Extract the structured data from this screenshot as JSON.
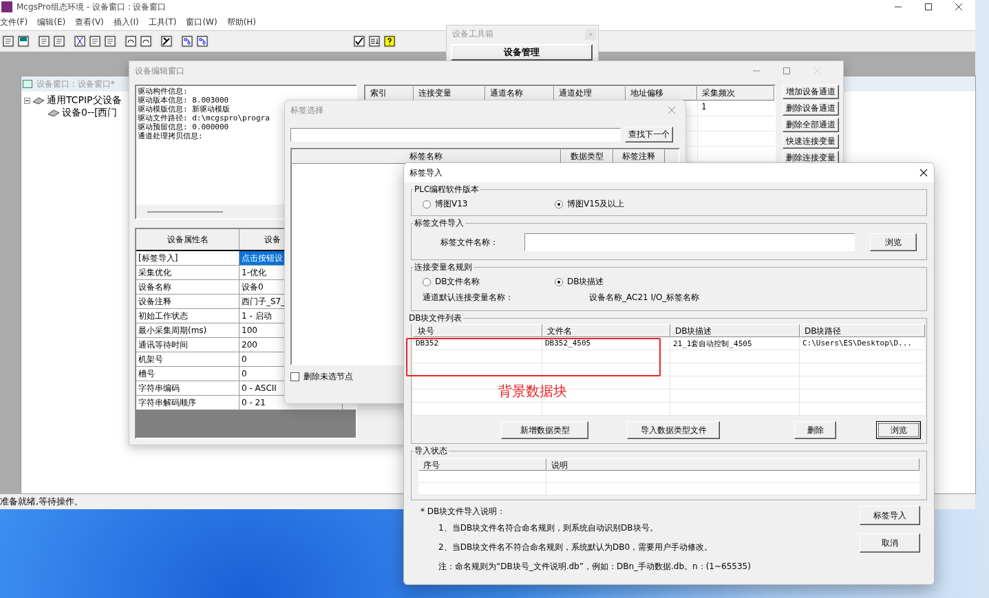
{
  "app": {
    "title": "McgsPro组态环境 - 设备窗口 : 设备窗口",
    "menu": [
      "文件(F)",
      "编辑(E)",
      "查看(V)",
      "插入(I)",
      "工具(T)",
      "窗口(W)",
      "帮助(H)"
    ],
    "status": "准备就绪,等待操作。"
  },
  "device_window": {
    "title": "设备窗口 : 设备窗口*",
    "tree": [
      {
        "label": "通用TCPIP父设备",
        "expanded": true,
        "children": [
          {
            "label": "设备0--[西门"
          }
        ]
      }
    ]
  },
  "toolbox": {
    "title": "设备工具箱",
    "button": "设备管理"
  },
  "editor": {
    "title": "设备编辑窗口",
    "info": [
      "驱动构件信息:",
      "驱动版本信息: 8.003000",
      "驱动模版信息: 新驱动模版",
      "驱动文件路径: d:\\mcgspro\\progra",
      "驱动预留信息: 0.000000",
      "通道处理拷贝信息:"
    ],
    "properties": {
      "columns": [
        "设备属性名",
        "设备"
      ],
      "rows": [
        {
          "name": "[标签导入]",
          "value": "点击按钮设",
          "selected": true
        },
        {
          "name": "采集优化",
          "value": "1-优化",
          "selected": false
        },
        {
          "name": "设备名称",
          "value": "设备0",
          "selected": false
        },
        {
          "name": "设备注释",
          "value": "西门子_S7_",
          "selected": false
        },
        {
          "name": "初始工作状态",
          "value": "1 - 启动",
          "selected": false
        },
        {
          "name": "最小采集周期(ms)",
          "value": "100",
          "selected": false
        },
        {
          "name": "通讯等待时间",
          "value": "200",
          "selected": false
        },
        {
          "name": "机架号",
          "value": "0",
          "selected": false
        },
        {
          "name": "槽号",
          "value": "0",
          "selected": false
        },
        {
          "name": "字符串编码",
          "value": "0 - ASCII",
          "selected": false
        },
        {
          "name": "字符串解码顺序",
          "value": "0 - 21",
          "selected": false
        }
      ]
    },
    "channels": {
      "columns": [
        "索引",
        "连接变量",
        "通道名称",
        "通道处理",
        "地址偏移",
        "采集频次"
      ],
      "frequency_value": "1"
    },
    "buttons": [
      "增加设备通道",
      "删除设备通道",
      "删除全部通道",
      "快速连接变量",
      "删除连接变量"
    ]
  },
  "tag_select": {
    "title": "标签选择",
    "find_button": "查找下一个",
    "columns": [
      "标签名称",
      "数据类型",
      "标签注释"
    ],
    "delete_unselected": {
      "label": "删除未选节点",
      "checked": false
    }
  },
  "tag_import": {
    "title": "标签导入",
    "plc_version": {
      "legend": "PLC编程软件版本",
      "options": [
        {
          "label": "博图V13",
          "selected": false
        },
        {
          "label": "博图V15及以上",
          "selected": true
        }
      ]
    },
    "tag_file": {
      "legend": "标签文件导入",
      "label": "标签文件名称：",
      "browse": "浏览"
    },
    "naming": {
      "legend": "连接变量名规则",
      "options": [
        {
          "label": "DB文件名称",
          "selected": false
        },
        {
          "label": "DB块描述",
          "selected": true
        }
      ],
      "default_label": "通道默认连接变量名称：",
      "default_value": "设备名称_AC21 I/O_标签名称"
    },
    "db_list": {
      "legend": "DB块文件列表",
      "columns": [
        "块号",
        "文件名",
        "DB块描述",
        "DB块路径"
      ],
      "rows": [
        [
          "DB352",
          "DB352_4505",
          "21_1套自动控制_4505",
          "C:\\Users\\ES\\Desktop\\D..."
        ]
      ],
      "buttons": [
        {
          "label": "新增数据类型",
          "focused": false
        },
        {
          "label": "导入数据类型文件",
          "focused": false
        },
        {
          "label": "删除",
          "focused": false
        },
        {
          "label": "浏览",
          "focused": true
        }
      ]
    },
    "import_status": {
      "legend": "导入状态",
      "columns": [
        "序号",
        "说明"
      ]
    },
    "notes": [
      "* DB块文件导入说明：",
      "1、当DB块文件名符合命名规则，则系统自动识别DB块号。",
      "2、当DB块文件名不符合命名规则，系统默认为DB0，需要用户手动修改。",
      "注：命名规则为“DB块号_文件说明.db”，例如：DBn_手动数据.db。n：(1~65535)"
    ],
    "actions": [
      "标签导入",
      "取消"
    ]
  },
  "annotation": {
    "label": "背景数据块"
  }
}
